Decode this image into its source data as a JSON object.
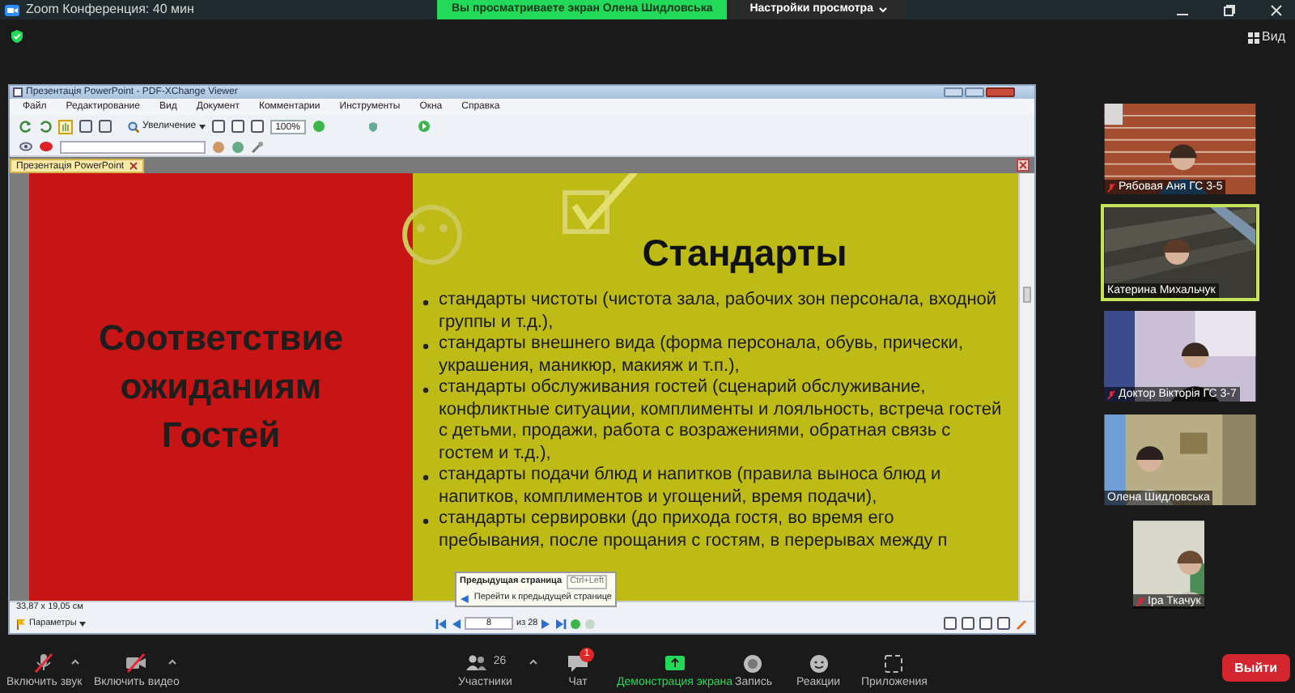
{
  "zoom_title": "Zoom Конференция: 40 мин",
  "share_banner": {
    "text": "Вы просматриваете экран Олена Шидловська",
    "options": "Настройки просмотра"
  },
  "view_button": "Вид",
  "viewer": {
    "title": "Презентація PowerPoint - PDF-XChange Viewer",
    "menu": [
      "Файл",
      "Редактирование",
      "Вид",
      "Документ",
      "Комментарии",
      "Инструменты",
      "Окна",
      "Справка"
    ],
    "zoom_tool": "Увеличение",
    "zoom_value": "100%",
    "tab": "Презентація PowerPoint",
    "slide": {
      "left_title": "Соответствие ожиданиям Гостей",
      "heading": "Стандарты",
      "bullets": [
        "стандарты чистоты (чистота зала, рабочих зон персонала, входной группы и т.д.),",
        "стандарты внешнего вида (форма персонала, обувь, прически, украшения, маникюр, макияж и т.п.),",
        "стандарты обслуживания гостей (сценарий обслуживание, конфликтные ситуации, комплименты и лояльность, встреча гостей с детьми, продажи, работа с возражениями, обратная связь с гостем и т.д.),",
        "стандарты подачи блюд и напитков (правила выноса блюд и напитков, комплиментов и угощений, время подачи),",
        "стандарты сервировки (до прихода гостя, во время его пребывания, после прощания с гостям, в перерывах между п"
      ]
    },
    "tooltip": {
      "title": "Предыдущая страница",
      "shortcut": "Ctrl+Left",
      "description": "Перейти к предыдущей странице"
    },
    "page_size": "33,87 x 19,05 см",
    "options": "Параметры",
    "page": "8",
    "page_count": "из 28"
  },
  "participants": [
    {
      "name": "Рябовая Аня ГС 3-5",
      "muted": true,
      "speaking": false
    },
    {
      "name": "Катерина Михальчук",
      "muted": false,
      "speaking": true
    },
    {
      "name": "Доктор Вікторія ГС 3-7",
      "muted": true,
      "speaking": false
    },
    {
      "name": "Олена Шидловська",
      "muted": false,
      "speaking": false
    },
    {
      "name": "Іра Ткачук",
      "muted": true,
      "speaking": false
    }
  ],
  "toolbar": [
    {
      "kind": "mic",
      "label": "Включить звук",
      "off": true
    },
    {
      "kind": "video",
      "label": "Включить видео",
      "off": true
    },
    {
      "kind": "participants",
      "label": "Участники",
      "count": "26"
    },
    {
      "kind": "chat",
      "label": "Чат",
      "badge": "1"
    },
    {
      "kind": "share",
      "label": "Демонстрация экрана"
    },
    {
      "kind": "record",
      "label": "Запись"
    },
    {
      "kind": "reactions",
      "label": "Реакции"
    },
    {
      "kind": "apps",
      "label": "Приложения"
    }
  ],
  "leave_button": "Выйти"
}
